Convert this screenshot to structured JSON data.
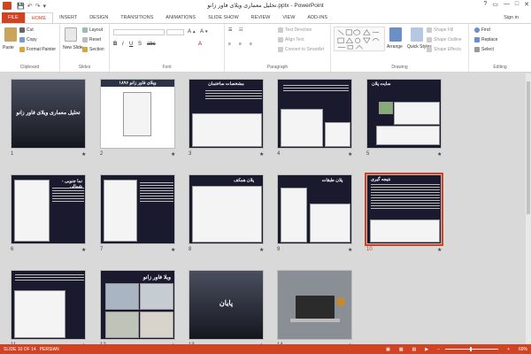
{
  "window": {
    "title": "تحلیل معماری ویلای فاور زانو.pptx - PowerPoint",
    "help": "?",
    "restore": "▭",
    "minimize": "—",
    "maximize": "□",
    "close": "✕"
  },
  "qat": [
    "💾",
    "↶",
    "↷",
    "▾"
  ],
  "tabs": [
    {
      "label": "FILE"
    },
    {
      "label": "HOME"
    },
    {
      "label": "INSERT"
    },
    {
      "label": "DESIGN"
    },
    {
      "label": "TRANSITIONS"
    },
    {
      "label": "ANIMATIONS"
    },
    {
      "label": "SLIDE SHOW"
    },
    {
      "label": "REVIEW"
    },
    {
      "label": "VIEW"
    },
    {
      "label": "ADD-INS"
    }
  ],
  "signin": "Sign in",
  "ribbon": {
    "clipboard": {
      "label": "Clipboard",
      "paste": "Paste",
      "cut": "Cut",
      "copy": "Copy",
      "format_painter": "Format Painter"
    },
    "slides": {
      "label": "Slides",
      "new_slide": "New Slide",
      "layout": "Layout",
      "reset": "Reset",
      "section": "Section"
    },
    "font": {
      "label": "Font"
    },
    "paragraph": {
      "label": "Paragraph",
      "text_direction": "Text Direction",
      "align_text": "Align Text",
      "convert": "Convert to SmartArt"
    },
    "drawing": {
      "label": "Drawing",
      "arrange": "Arrange",
      "quick_styles": "Quick Styles",
      "shape_fill": "Shape Fill",
      "shape_outline": "Shape Outline",
      "shape_effects": "Shape Effects"
    },
    "editing": {
      "label": "Editing",
      "find": "Find",
      "replace": "Replace",
      "select": "Select"
    }
  },
  "slides": [
    {
      "num": "1",
      "title": "تحلیل معماری ویلای فاور زانو"
    },
    {
      "num": "2",
      "title": "ویلای فاور زانو ۱۸۹۶"
    },
    {
      "num": "3",
      "title": "مشخصات ساختمان"
    },
    {
      "num": "4",
      "title": ""
    },
    {
      "num": "5",
      "title": "سایت پلان"
    },
    {
      "num": "6",
      "title": "نما جنوبی - شمالی"
    },
    {
      "num": "7",
      "title": ""
    },
    {
      "num": "8",
      "title": "پلان همکف"
    },
    {
      "num": "9",
      "title": "پلان طبقات"
    },
    {
      "num": "10",
      "title": "نتیجه گیری"
    },
    {
      "num": "11",
      "title": ""
    },
    {
      "num": "12",
      "title": "ویلا فاور زانو"
    },
    {
      "num": "13",
      "title": "پایان"
    },
    {
      "num": "14",
      "title": ""
    }
  ],
  "star": "★",
  "status": {
    "slide_of": "SLIDE 10 OF 14",
    "language": "PERSIAN",
    "zoom": "69%"
  },
  "colors": {
    "accent": "#d04423",
    "dark_slide": "#1a1a2e"
  }
}
